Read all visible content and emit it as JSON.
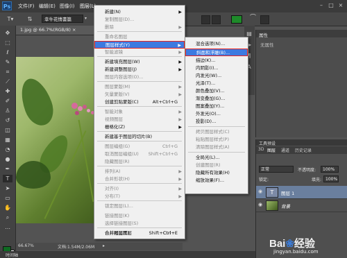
{
  "app_logo": "Ps",
  "menubar": {
    "items": [
      "文件(F)",
      "编辑(E)",
      "图像(I)",
      "图层(L)"
    ],
    "window_controls": [
      "–",
      "□",
      "×"
    ]
  },
  "options_bar": {
    "font_family": "幸牛花情書篇"
  },
  "document": {
    "tab_label": "1.jpg @ 66.7%(RGB/8) ×",
    "zoom": "66.67%",
    "doc_size": "文档:1.54M/2.06M"
  },
  "timeline_label": "时间轴",
  "layer_menu": {
    "items": [
      {
        "label": "新建(N)",
        "disabled": false,
        "arrow": true
      },
      {
        "label": "复制图层(D)...",
        "disabled": true
      },
      {
        "label": "删除",
        "disabled": true,
        "arrow": true
      },
      {
        "label": "重命名图层",
        "disabled": true
      },
      {
        "label": "图层样式(Y)",
        "active": true,
        "arrow": true
      },
      {
        "label": "智能滤镜",
        "disabled": true,
        "arrow": true
      },
      {
        "label": "新建填充图层(W)",
        "disabled": false,
        "arrow": true
      },
      {
        "label": "新建调整图层(J)",
        "disabled": false,
        "arrow": true
      },
      {
        "label": "图层内容选项(O)...",
        "disabled": true
      },
      {
        "label": "图层蒙版(M)",
        "disabled": true,
        "arrow": true
      },
      {
        "label": "矢量蒙版(V)",
        "disabled": true,
        "arrow": true
      },
      {
        "label": "创建剪贴蒙版(C)",
        "shortcut": "Alt+Ctrl+G"
      },
      {
        "label": "智能对象",
        "disabled": true,
        "arrow": true
      },
      {
        "label": "视频图层",
        "disabled": true,
        "arrow": true
      },
      {
        "label": "栅格化(Z)",
        "disabled": false,
        "arrow": true
      },
      {
        "label": "新建基于图层的切片(B)",
        "disabled": false
      },
      {
        "label": "图层编组(G)",
        "shortcut": "Ctrl+G",
        "disabled": true
      },
      {
        "label": "取消图层编组(U)",
        "shortcut": "Shift+Ctrl+G",
        "disabled": true
      },
      {
        "label": "隐藏图层(R)",
        "disabled": true
      },
      {
        "label": "排列(A)",
        "disabled": true,
        "arrow": true
      },
      {
        "label": "合并形状(H)",
        "disabled": true,
        "arrow": true
      },
      {
        "label": "对齐(I)",
        "disabled": true,
        "arrow": true
      },
      {
        "label": "分布(T)",
        "disabled": true,
        "arrow": true
      },
      {
        "label": "锁定图层(L)...",
        "disabled": true
      },
      {
        "label": "链接图层(K)",
        "disabled": true
      },
      {
        "label": "选择链接图层(S)",
        "disabled": true
      },
      {
        "label": "合并图层(E)",
        "shortcut": "Ctrl+E"
      },
      {
        "label": "合并可见图层",
        "shortcut": "Shift+Ctrl+E"
      }
    ]
  },
  "style_submenu": {
    "items": [
      {
        "label": "混合选项(N)..."
      },
      {
        "label": "斜面和浮雕(B)...",
        "active": true
      },
      {
        "label": "描边(K)..."
      },
      {
        "label": "内阴影(I)..."
      },
      {
        "label": "内发光(W)..."
      },
      {
        "label": "光泽(T)..."
      },
      {
        "label": "颜色叠加(V)..."
      },
      {
        "label": "渐变叠加(G)..."
      },
      {
        "label": "图案叠加(Y)..."
      },
      {
        "label": "外发光(O)..."
      },
      {
        "label": "投影(D)..."
      },
      {
        "label": "拷贝图层样式(C)",
        "disabled": true
      },
      {
        "label": "粘贴图层样式(P)",
        "disabled": true
      },
      {
        "label": "清除图层样式(A)",
        "disabled": true
      },
      {
        "label": "全局光(L)..."
      },
      {
        "label": "创建图层(R)",
        "disabled": true
      },
      {
        "label": "隐藏所有效果(H)"
      },
      {
        "label": "缩放效果(F)..."
      }
    ]
  },
  "properties_panel": {
    "title": "属性",
    "content": "无属性"
  },
  "layers_panel": {
    "header": "工具预设",
    "tabs": [
      "3D",
      "图层",
      "通道",
      "历史记录"
    ],
    "blend_mode": "正常",
    "opacity_label": "不透明度:",
    "opacity_value": "100%",
    "lock_label": "锁定:",
    "fill_label": "填充:",
    "fill_value": "100%",
    "layers": [
      {
        "name": "图层 1",
        "type": "text"
      },
      {
        "name": "背景",
        "type": "image"
      }
    ]
  },
  "watermark": {
    "brand": "Bai",
    "brand2": "经验",
    "url": "jingyan.baidu.com"
  },
  "colors": {
    "highlight": "#3d7ae0",
    "callout": "#e8231e",
    "foreground": "#0e6a22"
  }
}
